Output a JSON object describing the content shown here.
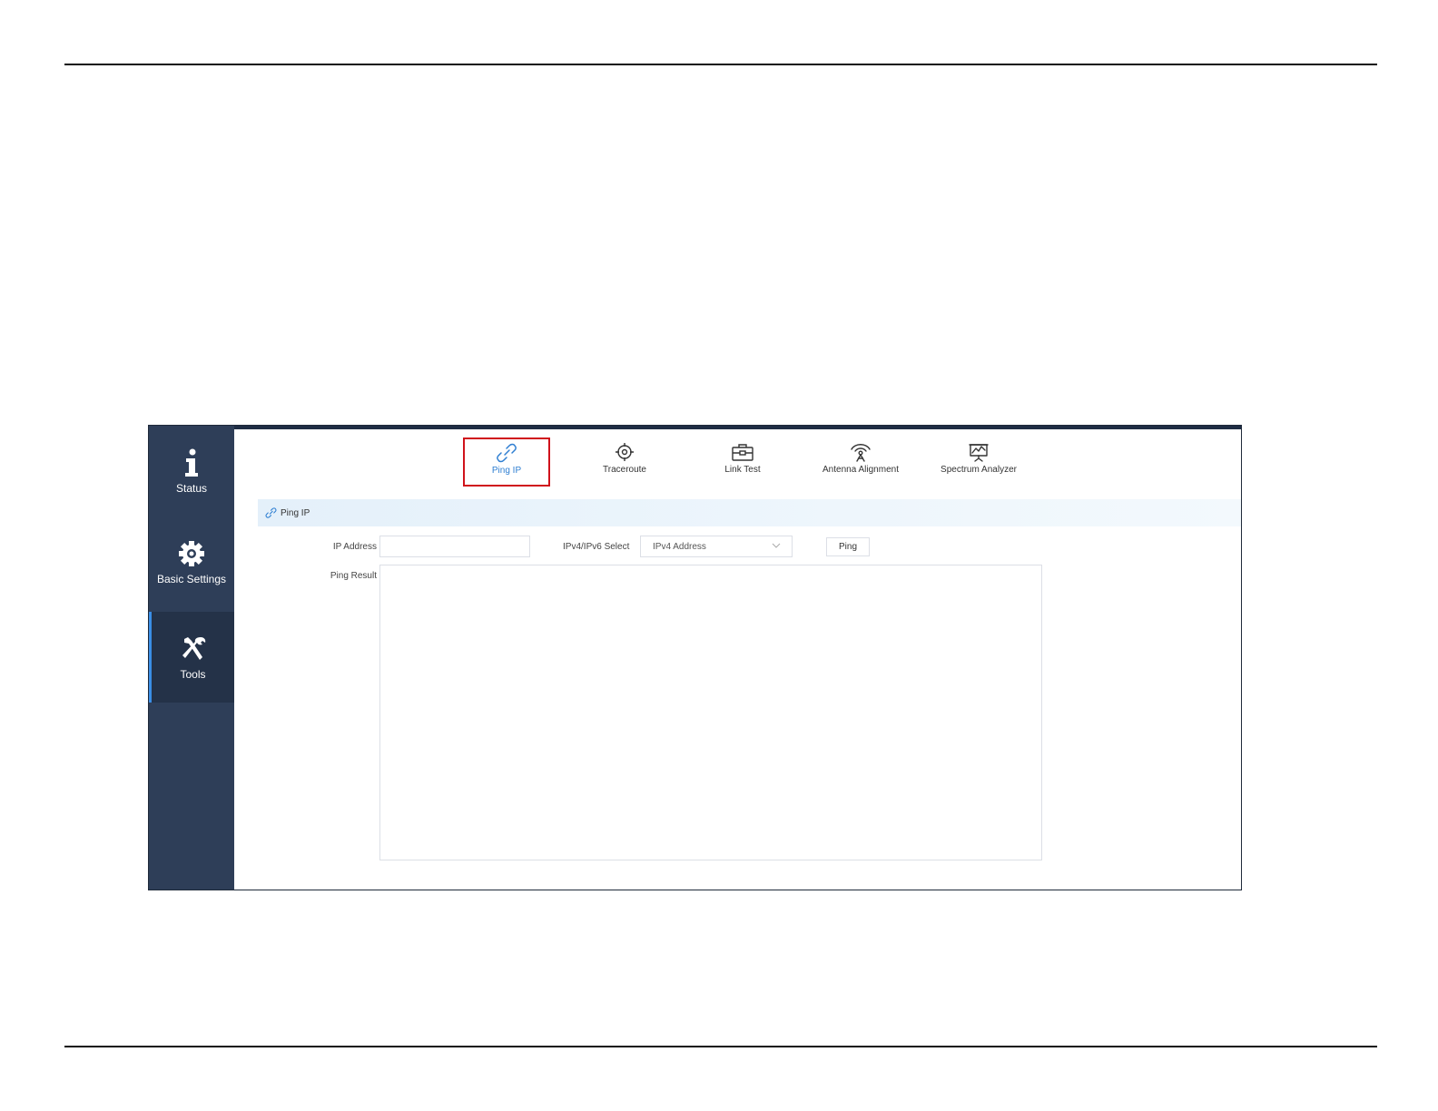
{
  "sidebar": {
    "items": [
      {
        "label": "Status",
        "icon": "info-icon"
      },
      {
        "label": "Basic Settings",
        "icon": "gear-icon"
      },
      {
        "label": "Tools",
        "icon": "tools-icon",
        "active": true
      }
    ]
  },
  "tools": {
    "items": [
      {
        "label": "Ping IP",
        "icon": "link-icon",
        "active": true
      },
      {
        "label": "Traceroute",
        "icon": "crosshair-icon"
      },
      {
        "label": "Link Test",
        "icon": "toolbox-icon"
      },
      {
        "label": "Antenna Alignment",
        "icon": "antenna-icon"
      },
      {
        "label": "Spectrum Analyzer",
        "icon": "spectrum-icon"
      }
    ]
  },
  "section": {
    "title": "Ping IP"
  },
  "form": {
    "ip_label": "IP Address",
    "ip_value": "",
    "select_label": "IPv4/IPv6 Select",
    "select_value": "IPv4 Address",
    "ping_button": "Ping",
    "result_label": "Ping Result",
    "result_value": ""
  },
  "colors": {
    "sidebar": "#2e3e58",
    "accent": "#2f7fd2",
    "highlight": "#d0121b"
  }
}
